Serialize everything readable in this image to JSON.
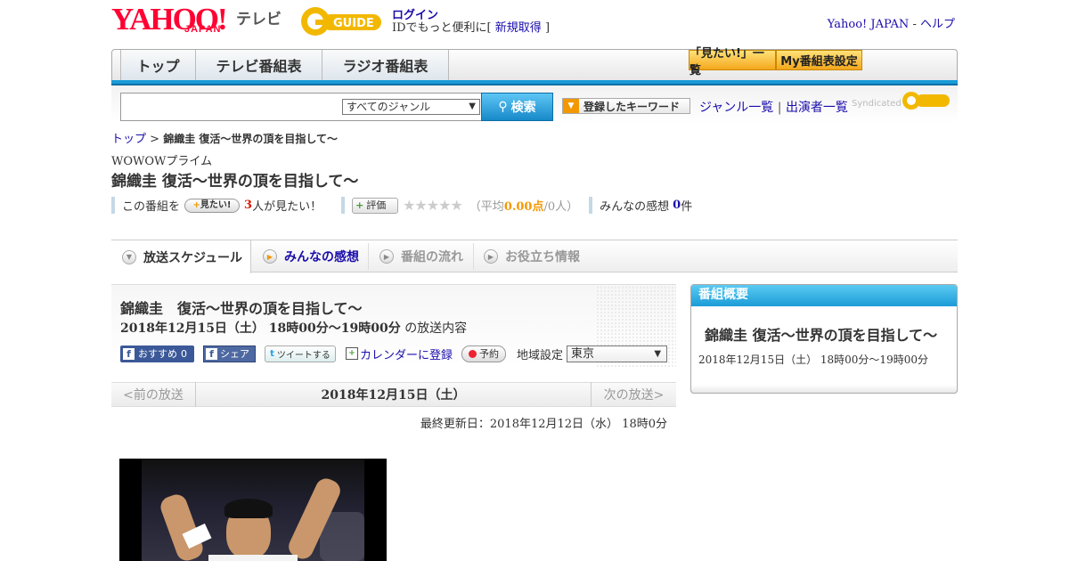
{
  "header": {
    "logo_yahoo": "YAHOO!",
    "logo_japan": "JAPAN",
    "logo_tv": "テレビ",
    "logo_gguide": "G GUIDE",
    "login": "ログイン",
    "login_sub_prefix": "IDでもっと便利に[",
    "signup": "新規取得",
    "login_sub_suffix": "]",
    "yahoo_japan_link": "Yahoo! JAPAN",
    "dash": "-",
    "help_link": "ヘルプ"
  },
  "nav": {
    "tabs": [
      "トップ",
      "テレビ番組表",
      "ラジオ番組表"
    ],
    "want_list": "「見たい!」一覧",
    "my_schedule": "My番組表設定"
  },
  "search": {
    "genre_selected": "すべてのジャンル",
    "search_button": "検索",
    "keyword_button": "登録したキーワード",
    "genre_list": "ジャンル一覧",
    "separator": "|",
    "performer_list": "出演者一覧",
    "syndicated": "Syndicated"
  },
  "breadcrumb": {
    "top": "トップ",
    "sep": ">",
    "current": "錦織圭 復活～世界の頂を目指して～"
  },
  "program": {
    "channel": "WOWOWプライム",
    "title": "錦織圭 復活～世界の頂を目指して～",
    "want_prefix": "この番組を",
    "want_button": "見たい!",
    "want_count": "3",
    "want_suffix": "人が見たい！",
    "rate_button": "評価",
    "stars": "★★★★★",
    "avg_open": "（平均",
    "avg_value": "0.00点",
    "avg_close": "/0人）",
    "impressions_label": "みんなの感想",
    "impressions_count": "0",
    "impressions_unit": "件"
  },
  "tabs": [
    {
      "label": "放送スケジュール"
    },
    {
      "label": "みんなの感想"
    },
    {
      "label": "番組の流れ"
    },
    {
      "label": "お役立ち情報"
    }
  ],
  "detail": {
    "title": "錦織圭　復活～世界の頂を目指して～",
    "datetime": "2018年12月15日（土） 18時00分～19時00分",
    "datetime_suffix": "の放送内容",
    "fb_recommend": "おすすめ",
    "fb_count": "0",
    "fb_share": "シェア",
    "tweet": "ツイートする",
    "calendar": "カレンダーに登録",
    "reserve": "予約",
    "region_label": "地域設定",
    "region_value": "東京",
    "prev": "<前の放送",
    "current_date": "2018年12月15日（土）",
    "next": "次の放送>",
    "updated": "最終更新日：2018年12月12日（水） 18時0分"
  },
  "sidebar": {
    "heading": "番組概要",
    "title": "錦織圭 復活～世界の頂を目指して～",
    "datetime": "2018年12月15日（土） 18時00分～19時00分"
  },
  "colors": {
    "accent_blue": "#1a9bd7",
    "yahoo_red": "#ff0033",
    "orange": "#f39800"
  }
}
